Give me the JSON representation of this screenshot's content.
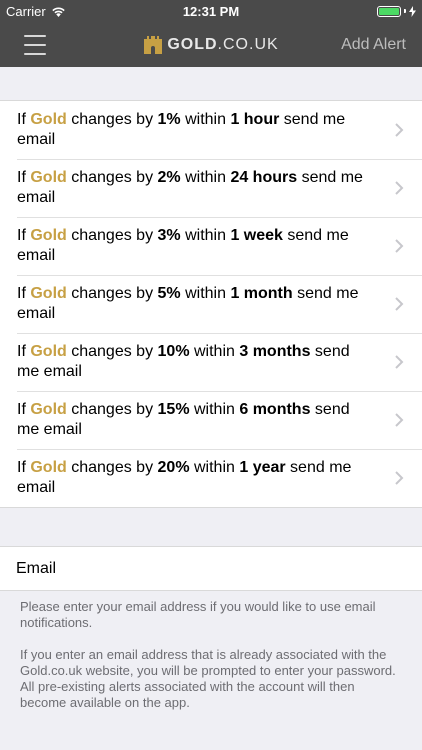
{
  "status_bar": {
    "carrier": "Carrier",
    "time": "12:31 PM"
  },
  "nav": {
    "logo_bold": "GOLD",
    "logo_light": ".CO.UK",
    "add_alert": "Add Alert"
  },
  "alerts": [
    {
      "pre": "If ",
      "metal": "Gold",
      "mid": " changes by ",
      "percent": "1%",
      "mid2": " within ",
      "period": "1 hour",
      "post": " send me email"
    },
    {
      "pre": "If ",
      "metal": "Gold",
      "mid": " changes by ",
      "percent": "2%",
      "mid2": " within ",
      "period": "24 hours",
      "post": " send me email"
    },
    {
      "pre": "If ",
      "metal": "Gold",
      "mid": " changes by ",
      "percent": "3%",
      "mid2": " within ",
      "period": "1 week",
      "post": " send me email"
    },
    {
      "pre": "If ",
      "metal": "Gold",
      "mid": " changes by ",
      "percent": "5%",
      "mid2": " within ",
      "period": "1 month",
      "post": " send me email"
    },
    {
      "pre": "If ",
      "metal": "Gold",
      "mid": " changes by ",
      "percent": "10%",
      "mid2": " within ",
      "period": "3 months",
      "post": " send me email"
    },
    {
      "pre": "If ",
      "metal": "Gold",
      "mid": " changes by ",
      "percent": "15%",
      "mid2": " within ",
      "period": "6 months",
      "post": " send me email"
    },
    {
      "pre": "If ",
      "metal": "Gold",
      "mid": " changes by ",
      "percent": "20%",
      "mid2": " within ",
      "period": "1 year",
      "post": " send me email"
    }
  ],
  "email": {
    "label": "Email",
    "value": ""
  },
  "notes": {
    "p1": "Please enter your email address if you would like to use email notifications.",
    "p2": "If you enter an email address that is already associated with the Gold.co.uk website, you will be prompted to enter your password. All pre-existing alerts associated with the account will then become available on the app."
  },
  "colors": {
    "nav_bg": "#4a4a4a",
    "gold_accent": "#c7a044",
    "battery": "#4cd964"
  },
  "icons": {
    "menu": "hamburger-menu-icon",
    "logo": "castle-icon",
    "row": "chevron-right-icon"
  }
}
